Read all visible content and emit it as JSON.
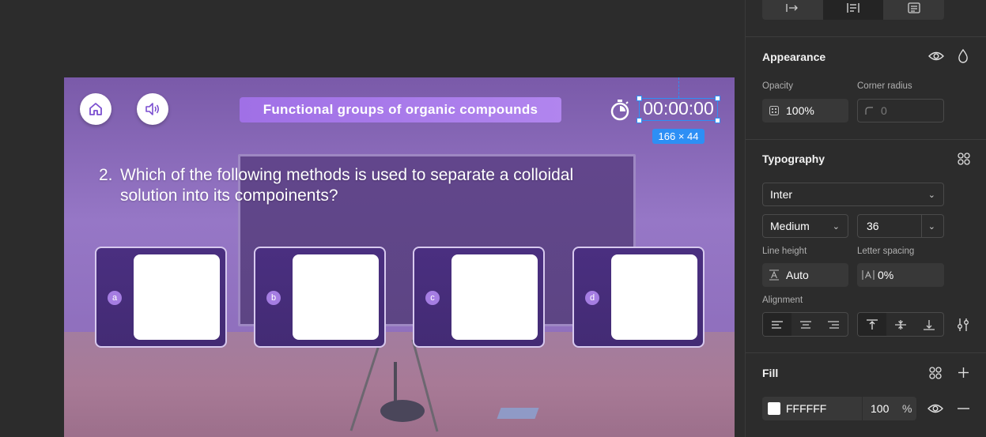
{
  "game": {
    "title": "Functional groups of organic compounds",
    "timer": "00:00:00",
    "selection_size": "166 × 44",
    "question_number": "2.",
    "question_text": "Which of the following methods is used to separate a colloidal solution into its compoinents?",
    "options": [
      {
        "letter": "a"
      },
      {
        "letter": "b"
      },
      {
        "letter": "c"
      },
      {
        "letter": "d"
      }
    ],
    "buttons": {
      "home": "home-icon",
      "sound": "speaker-icon"
    }
  },
  "panel": {
    "appearance": {
      "title": "Appearance",
      "opacity_label": "Opacity",
      "opacity_value": "100%",
      "corner_radius_label": "Corner radius",
      "corner_radius_placeholder": "0"
    },
    "typography": {
      "title": "Typography",
      "font_family": "Inter",
      "font_weight": "Medium",
      "font_size": "36",
      "line_height_label": "Line height",
      "line_height_value": "Auto",
      "letter_spacing_label": "Letter spacing",
      "letter_spacing_value": "0%",
      "alignment_label": "Alignment"
    },
    "fill": {
      "title": "Fill",
      "color_hex": "FFFFFF",
      "opacity": "100",
      "percent": "%"
    }
  },
  "colors": {
    "selection_blue": "#2d8ff5",
    "title_pill": "#a070e6",
    "option_card": "#4a2f80",
    "panel_bg": "#2c2c2c"
  }
}
